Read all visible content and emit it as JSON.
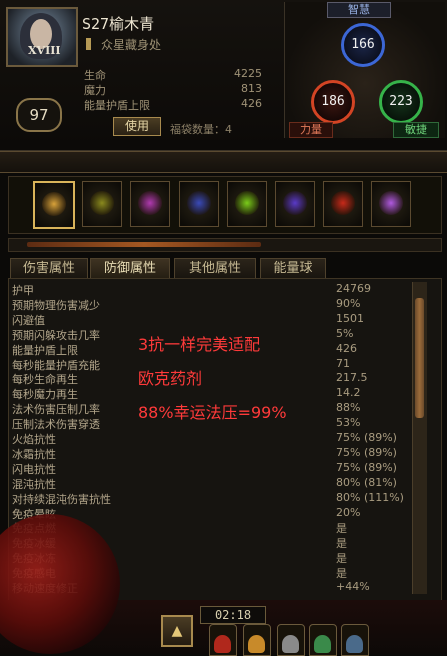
{
  "character": {
    "name": "S27榆木青",
    "guild": "众星藏身处",
    "level": "97",
    "rank_numeral": "XVIII",
    "stats": [
      {
        "label": "生命",
        "value": "4225"
      },
      {
        "label": "魔力",
        "value": "813"
      },
      {
        "label": "能量护盾上限",
        "value": "426"
      }
    ],
    "use_button": "使用",
    "bag_label": "福袋数量：4"
  },
  "attributes": {
    "intelligence": {
      "label": "智慧",
      "value": "166"
    },
    "strength": {
      "label": "力量",
      "value": "186"
    },
    "dexterity": {
      "label": "敏捷",
      "value": "223"
    }
  },
  "slots": [
    {
      "icon": "sword-icon",
      "color": "#d8a23a"
    },
    {
      "icon": "spell-icon",
      "color": "#8a8a1e"
    },
    {
      "icon": "orb-icon",
      "color": "#b03ab0"
    },
    {
      "icon": "shield-icon",
      "color": "#3a4ab8"
    },
    {
      "icon": "skill-icon",
      "color": "#7acc1a"
    },
    {
      "icon": "rune-icon",
      "color": "#5a3ac8"
    },
    {
      "icon": "fire-icon",
      "color": "#c82a1a"
    },
    {
      "icon": "arcane-icon",
      "color": "#b05ae0"
    }
  ],
  "exp_bar_fraction": 0.59,
  "tabs": [
    "伤害属性",
    "防御属性",
    "其他属性",
    "能量球"
  ],
  "active_tab": 1,
  "defense_stats": [
    {
      "label": "护甲",
      "value": "24769"
    },
    {
      "label": "预期物理伤害减少",
      "value": "90%"
    },
    {
      "label": "闪避值",
      "value": "1501"
    },
    {
      "label": "预期闪躲攻击几率",
      "value": "5%"
    },
    {
      "label": "能量护盾上限",
      "value": "426"
    },
    {
      "label": "每秒能量护盾充能",
      "value": "71"
    },
    {
      "label": "每秒生命再生",
      "value": "217.5"
    },
    {
      "label": "每秒魔力再生",
      "value": "14.2"
    },
    {
      "label": "法术伤害压制几率",
      "value": "88%"
    },
    {
      "label": "压制法术伤害穿透",
      "value": "53%"
    },
    {
      "label": "火焰抗性",
      "value": "75% (89%)"
    },
    {
      "label": "冰霜抗性",
      "value": "75% (89%)"
    },
    {
      "label": "闪电抗性",
      "value": "75% (89%)"
    },
    {
      "label": "混沌抗性",
      "value": "80% (81%)"
    },
    {
      "label": "对持续混沌伤害抗性",
      "value": "80% (111%)"
    },
    {
      "label": "免疫晕眩",
      "value": "20%"
    },
    {
      "label": "免疫点燃",
      "value": "是"
    },
    {
      "label": "免疫冰缓",
      "value": "是"
    },
    {
      "label": "免疫冰冻",
      "value": "是"
    },
    {
      "label": "免疫感电",
      "value": "是"
    },
    {
      "label": "移动速度修正",
      "value": "+44%"
    }
  ],
  "overlay_notes": [
    "3抗一样完美适配",
    "欧克药剂",
    "88%幸运法压=99%"
  ],
  "hud": {
    "timer": "02:18"
  },
  "colors": {
    "overlay_text": "#ff3a3a",
    "intelligence": "#3c67d6",
    "strength": "#d34424",
    "dexterity": "#36b34a"
  }
}
